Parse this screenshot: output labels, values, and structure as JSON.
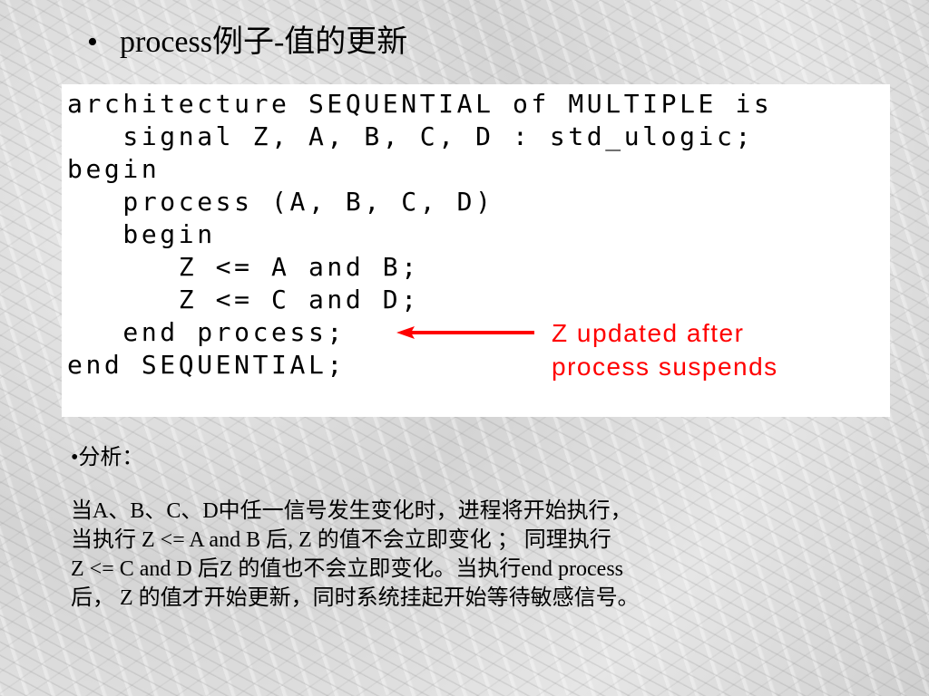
{
  "title": {
    "bullet": "•",
    "text": "process例子-值的更新"
  },
  "code": {
    "lines": [
      "architecture SEQUENTIAL of MULTIPLE is",
      "   signal Z, A, B, C, D : std_ulogic;",
      "begin",
      "   process (A, B, C, D)",
      "   begin",
      "      Z <= A and B;",
      "      Z <= C and D;",
      "   end process;",
      "end SEQUENTIAL;"
    ],
    "annotation": {
      "lines": [
        "Z updated after",
        "process suspends"
      ],
      "color": "#ff0000",
      "points_to_line": "   end process;"
    }
  },
  "analysis": {
    "heading": "•分析：",
    "lines": [
      "当A、B、C、D中任一信号发生变化时，进程将开始执行，",
      "当执行 Z <= A and B 后, Z 的值不会立即变化 ； 同理执行",
      "Z <= C and D 后Z 的值也不会立即变化。当执行end process",
      "后， Z 的值才开始更新，同时系统挂起开始等待敏感信号。"
    ]
  }
}
